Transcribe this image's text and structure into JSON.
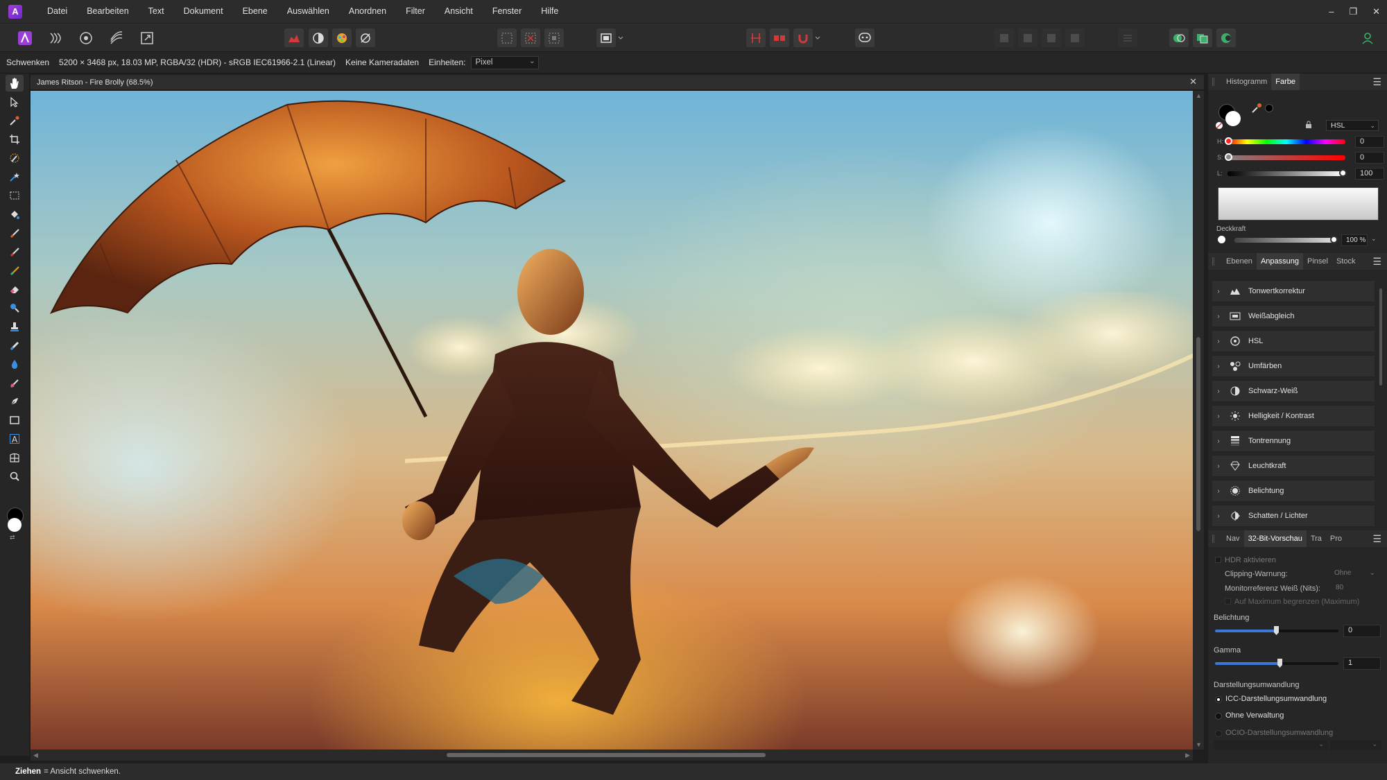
{
  "menubar": {
    "items": [
      "Datei",
      "Bearbeiten",
      "Text",
      "Dokument",
      "Ebene",
      "Auswählen",
      "Anordnen",
      "Filter",
      "Ansicht",
      "Fenster",
      "Hilfe"
    ]
  },
  "window_controls": {
    "minimize": "–",
    "restore": "❐",
    "close": "✕"
  },
  "contextbar": {
    "tool": "Schwenken",
    "doc_info": "5200 × 3468 px, 18.03 MP, RGBA/32 (HDR) - sRGB IEC61966-2.1 (Linear)",
    "camera": "Keine Kameradaten",
    "units_label": "Einheiten:",
    "units_value": "Pixel"
  },
  "document": {
    "tab_title": "James Ritson - Fire Brolly (68.5%)",
    "close": "✕"
  },
  "statusbar": {
    "key": "Ziehen",
    "text": "= Ansicht schwenken."
  },
  "color_panel": {
    "tabs": [
      "Histogramm",
      "Farbe"
    ],
    "active_tab": "Farbe",
    "model": "HSL",
    "h_label": "H:",
    "h_value": "0",
    "s_label": "S:",
    "s_value": "0",
    "l_label": "L:",
    "l_value": "100",
    "opacity_label": "Deckkraft",
    "opacity_value": "100 %"
  },
  "adjust_panel": {
    "tabs": [
      "Ebenen",
      "Anpassung",
      "Pinsel",
      "Stock"
    ],
    "active_tab": "Anpassung",
    "items": [
      "Tonwertkorrektur",
      "Weißabgleich",
      "HSL",
      "Umfärben",
      "Schwarz-Weiß",
      "Helligkeit / Kontrast",
      "Tontrennung",
      "Leuchtkraft",
      "Belichtung",
      "Schatten / Lichter"
    ]
  },
  "preview_panel": {
    "tabs": [
      "Nav",
      "32-Bit-Vorschau",
      "Tra",
      "Pro"
    ],
    "active_tab": "32-Bit-Vorschau",
    "hdr_label": "HDR aktivieren",
    "clipping_label": "Clipping-Warnung:",
    "clipping_value": "Ohne",
    "monitor_label": "Monitorreferenz Weiß (Nits):",
    "monitor_value": "80",
    "limit_label": "Auf Maximum begrenzen (Maximum)",
    "exposure_label": "Belichtung",
    "exposure_value": "0",
    "gamma_label": "Gamma",
    "gamma_value": "1",
    "display_label": "Darstellungsumwandlung",
    "options": [
      "ICC-Darstellungsumwandlung",
      "Ohne Verwaltung",
      "OCIO-Darstellungsumwandlung"
    ],
    "selected_option": "ICC-Darstellungsumwandlung"
  },
  "colors": {
    "accent": "#3d78d8",
    "brand": "#9b3fd6",
    "panel": "#262626"
  }
}
